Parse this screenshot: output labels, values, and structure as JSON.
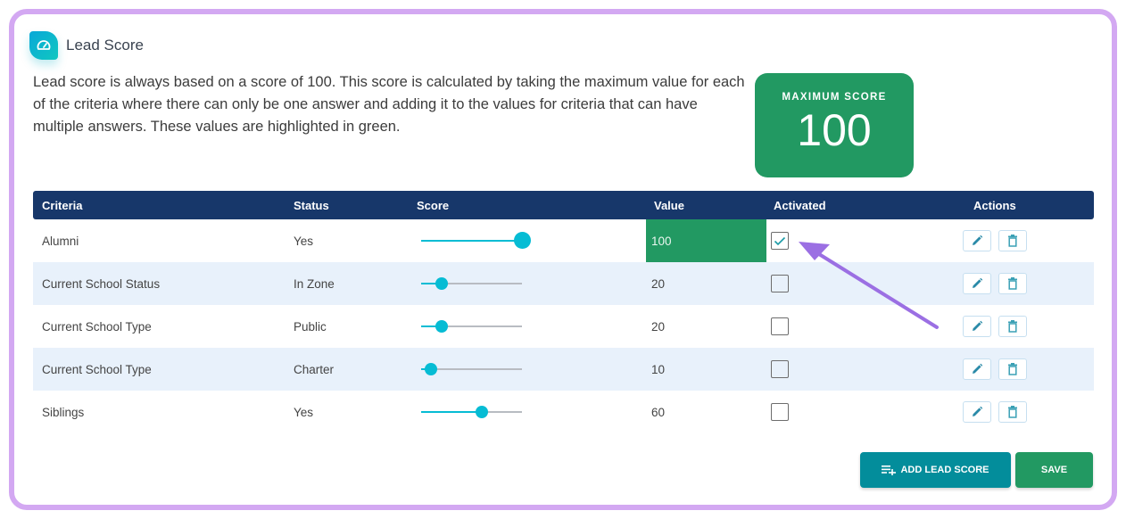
{
  "header": {
    "title": "Lead Score",
    "icon": "speedometer-icon"
  },
  "description": "Lead score is always based on a score of 100. This score is calculated by taking the maximum value for each of the criteria where there can only be one answer and adding it to the values for criteria that can have multiple answers. These values are highlighted in green.",
  "max_score": {
    "label": "MAXIMUM SCORE",
    "value": "100"
  },
  "table": {
    "columns": [
      "Criteria",
      "Status",
      "Score",
      "Value",
      "Activated",
      "Actions"
    ],
    "rows": [
      {
        "criteria": "Alumni",
        "status": "Yes",
        "score": 100,
        "value": "100",
        "activated": true,
        "highlighted": true
      },
      {
        "criteria": "Current School Status",
        "status": "In Zone",
        "score": 20,
        "value": "20",
        "activated": false,
        "highlighted": false
      },
      {
        "criteria": "Current School Type",
        "status": "Public",
        "score": 20,
        "value": "20",
        "activated": false,
        "highlighted": false
      },
      {
        "criteria": "Current School Type",
        "status": "Charter",
        "score": 10,
        "value": "10",
        "activated": false,
        "highlighted": false
      },
      {
        "criteria": "Siblings",
        "status": "Yes",
        "score": 60,
        "value": "60",
        "activated": false,
        "highlighted": false
      }
    ],
    "score_max": 100
  },
  "buttons": {
    "add_label": "ADD LEAD SCORE",
    "save_label": "SAVE"
  },
  "colors": {
    "accent_green": "#229962",
    "header_navy": "#17376a",
    "slider_cyan": "#06bcd4",
    "annotation_purple": "#9b6fe3",
    "frame_purple": "#d3a8f2"
  }
}
